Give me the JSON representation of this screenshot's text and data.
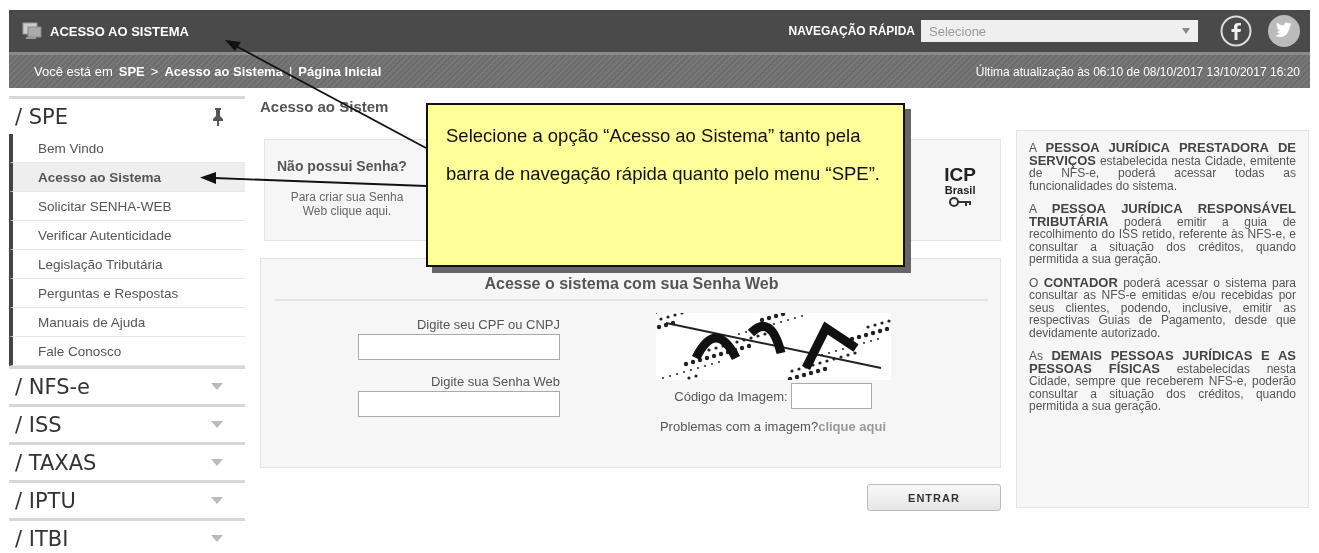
{
  "header": {
    "title": "ACESSO AO SISTEMA",
    "quick_nav_label": "NAVEGAÇÃO RÁPIDA",
    "quick_nav_select": {
      "placeholder": "Selecione"
    }
  },
  "breadcrumb": {
    "prefix": "Você está em",
    "items": [
      {
        "kind": "link",
        "text": "SPE"
      },
      {
        "kind": "sep",
        "text": ">"
      },
      {
        "kind": "link",
        "text": "Acesso ao Sistema"
      },
      {
        "kind": "sep",
        "text": "|"
      },
      {
        "kind": "link",
        "text": "Página Inicial"
      }
    ],
    "updated": "Última atualização às 06:10 de 08/10/2017  13/10/2017 16:20"
  },
  "sidebar": {
    "sections": [
      {
        "title": "/ SPE",
        "expanded": true,
        "items": [
          {
            "label": "Bem Vindo",
            "selected": false
          },
          {
            "label": "Acesso ao Sistema",
            "selected": true
          },
          {
            "label": "Solicitar SENHA-WEB",
            "selected": false
          },
          {
            "label": "Verificar Autenticidade",
            "selected": false
          },
          {
            "label": "Legislação Tributária",
            "selected": false
          },
          {
            "label": "Perguntas e Respostas",
            "selected": false
          },
          {
            "label": "Manuais de Ajuda",
            "selected": false
          },
          {
            "label": "Fale Conosco",
            "selected": false
          }
        ]
      },
      {
        "title": "/ NFS-e",
        "expanded": false
      },
      {
        "title": "/ ISS",
        "expanded": false
      },
      {
        "title": "/ TAXAS",
        "expanded": false
      },
      {
        "title": "/ IPTU",
        "expanded": false
      },
      {
        "title": "/ ITBI",
        "expanded": false
      }
    ]
  },
  "main": {
    "title": "Acesso ao Sistem",
    "no_password_card": {
      "title": "Não possui Senha?",
      "text": "Para criar sua Senha Web clique aqui."
    },
    "icp_logo": {
      "line1": "ICP",
      "line2": "Brasil"
    },
    "login": {
      "title": "Acesse o sistema com sua Senha Web",
      "cpf_label": "Digite seu CPF ou CNPJ",
      "password_label": "Digite sua Senha Web",
      "captcha_label": "Código da Imagem:",
      "captcha_problem": "Problemas com a imagem?",
      "captcha_link": "clique aqui",
      "submit": "ENTRAR"
    }
  },
  "info": {
    "paragraphs": [
      "A **PESSOA JURÍDICA PRESTADORA DE SERVIÇOS** estabelecida nesta Cidade, emitente de NFS-e, poderá acessar todas as funcionalidades do sistema.",
      "A **PESSOA JURÍDICA RESPONSÁVEL TRIBUTÁRIA** poderá emitir a guia de recolhimento do ISS retido, referente às NFS-e, e consultar a situação dos créditos, quando permitida a sua geração.",
      "O **CONTADOR** poderá acessar o sistema para consultar as NFS-e emitidas e/ou recebidas por seus clientes, podendo, inclusive, emitir as respectivas Guias de Pagamento, desde que devidamente autorizado.",
      "As **DEMAIS PESSOAS JURÍDICAS E AS PESSOAS FÍSICAS** estabelecidas nesta Cidade, sempre que receberem NFS-e, poderão consultar a situação dos créditos, quando permitida a sua geração."
    ]
  },
  "callout": {
    "text": "Selecione a opção “Acesso ao Sistema” tanto pela  barra de navegação rápida quanto pelo menu “SPE”."
  }
}
